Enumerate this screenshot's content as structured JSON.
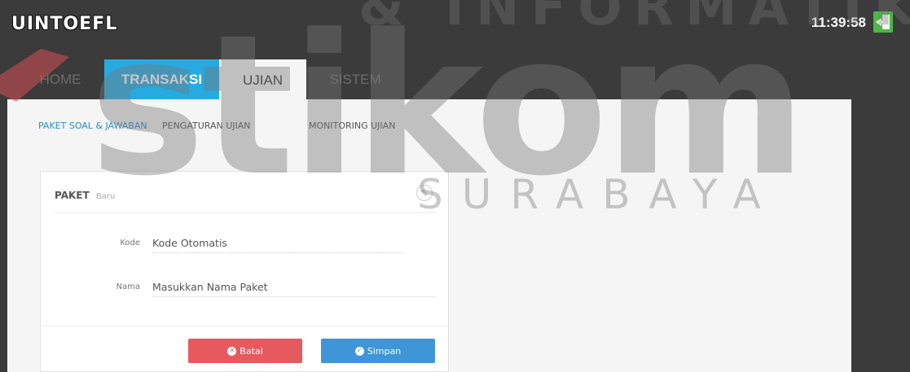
{
  "app": {
    "brand": "UINTOEFL",
    "clock": "11:39:58"
  },
  "nav": {
    "tabs": [
      {
        "label": "HOME",
        "active": false
      },
      {
        "label": "TRANSAKSI",
        "active": false,
        "highlight": true
      },
      {
        "label": "UJIAN",
        "active": true
      },
      {
        "label": "SISTEM",
        "active": false
      }
    ]
  },
  "subnav": {
    "items": [
      {
        "label": "PAKET SOAL & JAWABAN",
        "active": true
      },
      {
        "label": "PENGATURAN UJIAN",
        "active": false
      },
      {
        "label": "MONITORING UJIAN",
        "active": false
      }
    ]
  },
  "panel": {
    "title": "PAKET",
    "subtitle": "Baru",
    "tool_icon": "pencil-icon"
  },
  "form": {
    "kode_label": "Kode",
    "kode_value": "Kode Otomatis",
    "nama_label": "Nama",
    "nama_placeholder": "Masukkan Nama Paket"
  },
  "buttons": {
    "batal": "Batal",
    "simpan": "Simpan"
  },
  "watermark": {
    "top": "& INFORMATIKA",
    "main": "stikom",
    "sub": "SURABAYA"
  },
  "colors": {
    "accent": "#27a9e1",
    "batal": "#e65a5f",
    "simpan": "#3e95d7",
    "header": "#3b3b3b"
  }
}
